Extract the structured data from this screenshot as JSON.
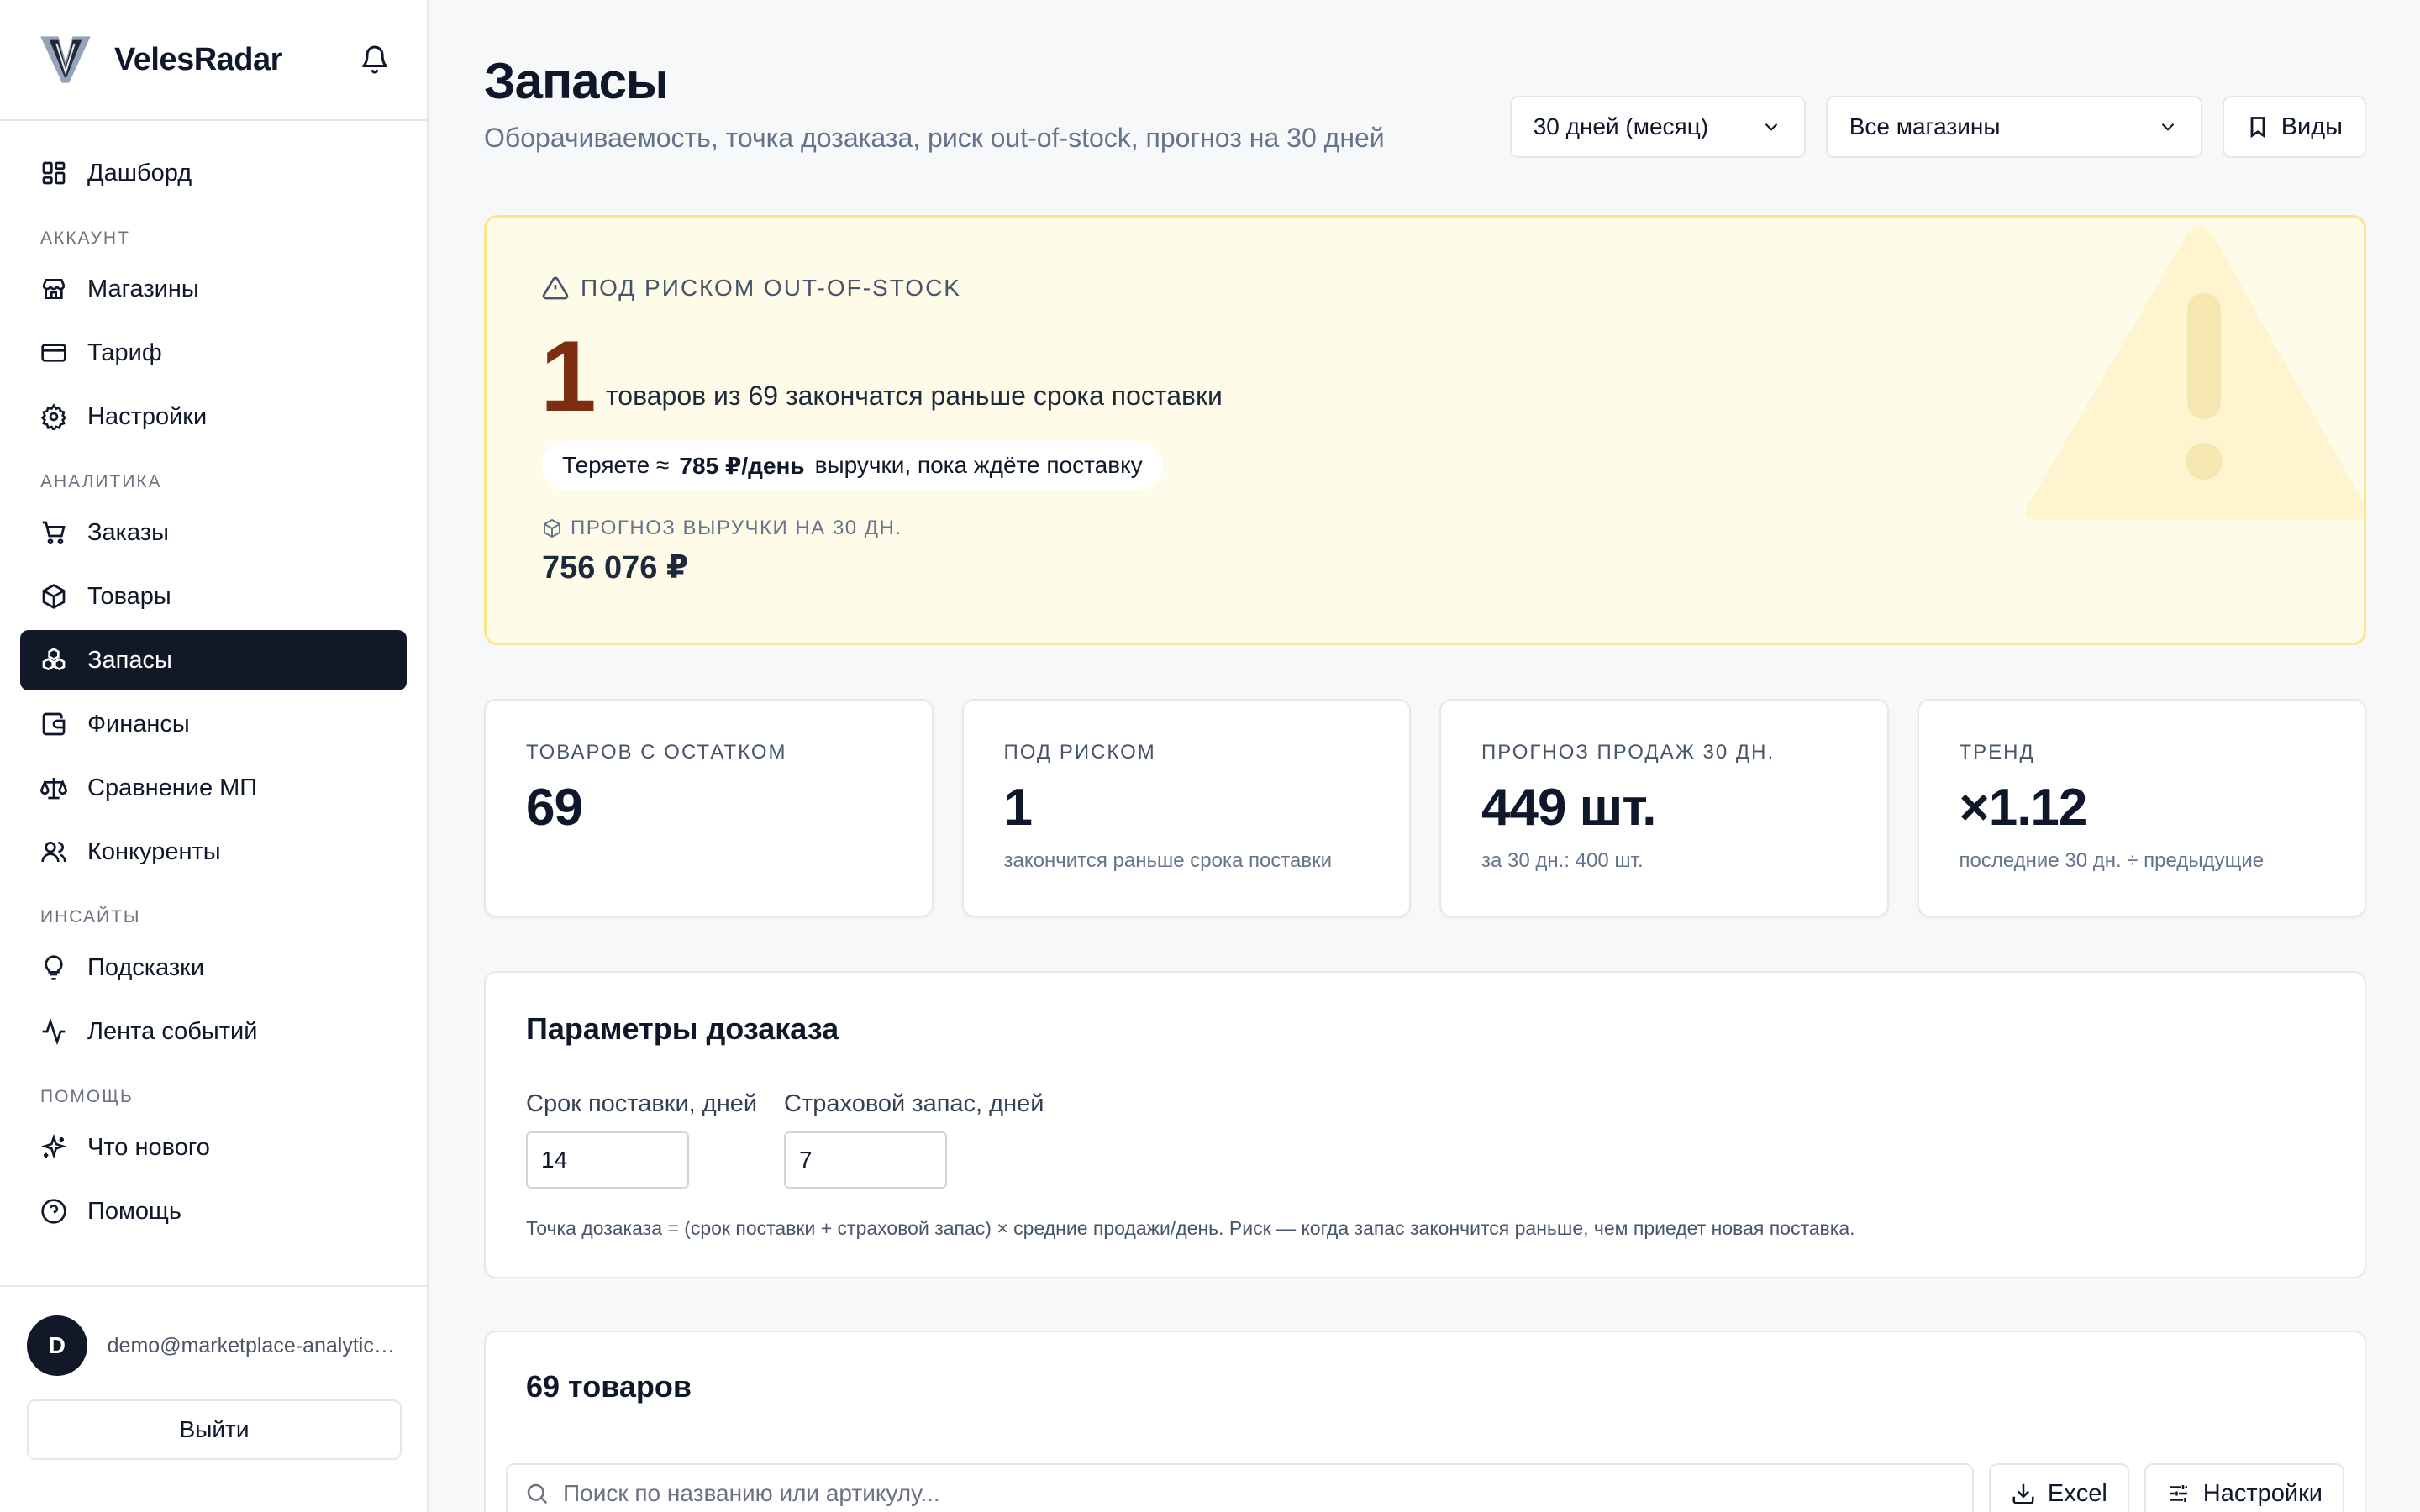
{
  "brand": {
    "name": "VelesRadar"
  },
  "nav": {
    "dashboard": "Дашборд",
    "section_account": "Аккаунт",
    "stores": "Магазины",
    "tariff": "Тариф",
    "settings": "Настройки",
    "section_analytics": "Аналитика",
    "orders": "Заказы",
    "products": "Товары",
    "stock": "Запасы",
    "finance": "Финансы",
    "compare": "Сравнение МП",
    "competitors": "Конкуренты",
    "section_insights": "Инсайты",
    "tips": "Подсказки",
    "events": "Лента событий",
    "section_help": "Помощь",
    "whats_new": "Что нового",
    "help": "Помощь"
  },
  "user": {
    "initial": "D",
    "email": "demo@marketplace-analytics.ru",
    "logout": "Выйти"
  },
  "header": {
    "title": "Запасы",
    "subtitle": "Оборачиваемость, точка дозаказа, риск out-of-stock, прогноз на 30 дней",
    "period": "30 дней (месяц)",
    "stores": "Все магазины",
    "views": "Виды"
  },
  "alert": {
    "label": "ПОД РИСКОМ OUT-OF-STOCK",
    "count": "1",
    "text": "товаров из 69 закончатся раньше срока поставки",
    "loss_prefix": "Теряете ≈",
    "loss_value": "785 ₽/день",
    "loss_suffix": "выручки, пока ждёте поставку",
    "forecast_label": "ПРОГНОЗ ВЫРУЧКИ НА 30 ДН.",
    "forecast_value": "756 076 ₽"
  },
  "stats": [
    {
      "label": "Товаров с остатком",
      "value": "69",
      "hint": ""
    },
    {
      "label": "Под риском",
      "value": "1",
      "hint": "закончится раньше срока поставки"
    },
    {
      "label": "Прогноз продаж 30 дн.",
      "value": "449 шт.",
      "hint": "за 30 дн.: 400 шт."
    },
    {
      "label": "Тренд",
      "value": "×1.12",
      "hint": "последние 30 дн. ÷ предыдущие"
    }
  ],
  "params": {
    "title": "Параметры дозаказа",
    "lead_label": "Срок поставки, дней",
    "lead_value": "14",
    "safety_label": "Страховой запас, дней",
    "safety_value": "7",
    "note": "Точка дозаказа = (срок поставки + страховой запас) × средние продажи/день. Риск — когда запас закончится раньше, чем приедет новая поставка."
  },
  "products": {
    "title": "69 товаров",
    "search_placeholder": "Поиск по названию или артикулу...",
    "excel": "Excel",
    "settings": "Настройки"
  },
  "icons": {
    "logo": "veles-logo-icon",
    "bell": "bell-icon",
    "dashboard": "grid-icon",
    "stores": "store-icon",
    "tariff": "card-icon",
    "settings": "gear-icon",
    "orders": "cart-icon",
    "products": "box-icon",
    "stock": "boxes-icon",
    "finance": "wallet-icon",
    "compare": "scale-icon",
    "competitors": "users-icon",
    "tips": "bulb-icon",
    "events": "activity-icon",
    "whats_new": "sparkles-icon",
    "help": "help-icon"
  },
  "colors": {
    "accent": "#111827",
    "alert_bg": "#fefbe8",
    "alert_border": "#fde68a",
    "alert_number": "#7c2d12"
  }
}
